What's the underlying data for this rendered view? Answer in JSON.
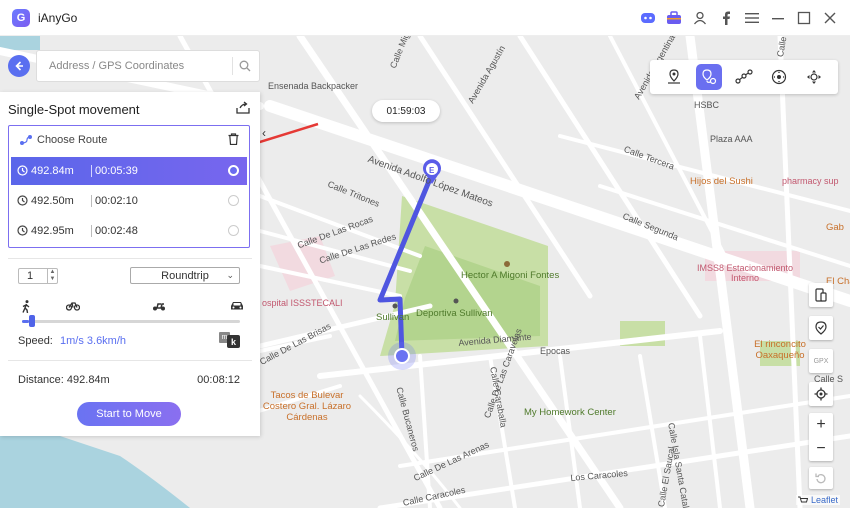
{
  "app": {
    "name": "iAnyGo",
    "logo_letter": "G"
  },
  "titlebar_icons": [
    "discord-icon",
    "toolbox-icon",
    "user-icon",
    "facebook-icon",
    "menu-icon",
    "minimize-icon",
    "maximize-icon",
    "close-icon"
  ],
  "search": {
    "placeholder": "Address / GPS Coordinates"
  },
  "panel": {
    "title": "Single-Spot movement",
    "choose_route_label": "Choose Route",
    "routes": [
      {
        "distance": "492.84m",
        "time": "00:05:39",
        "selected": true
      },
      {
        "distance": "492.50m",
        "time": "00:02:10",
        "selected": false
      },
      {
        "distance": "492.95m",
        "time": "00:02:48",
        "selected": false
      }
    ],
    "repeat_count": "1",
    "trip_mode": "Roundtrip",
    "speed_label": "Speed:",
    "speed_value": "1m/s  3.6km/h",
    "speed_fraction": 0.03,
    "speed_modes": [
      "walk-icon",
      "bike-icon",
      "scooter-icon",
      "car-icon"
    ],
    "distance_label": "Distance: 492.84m",
    "total_time": "00:08:12",
    "start_button": "Start to Move",
    "mk_m": "m",
    "mk_k": "k"
  },
  "timer": "01:59:03",
  "mode_bar": [
    "teleport-icon",
    "single-spot-icon",
    "multi-spot-icon",
    "joystick-icon",
    "jump-teleport-icon"
  ],
  "right_tools": {
    "gpx_label": "GPX"
  },
  "zoom": {
    "in": "+",
    "out": "−"
  },
  "attribution": "Leaflet",
  "map_labels": [
    "Ensenada Backpacker",
    "Calle Miguel Hidalgo",
    "Avenida Agustín",
    "Avenida Argentina",
    "Calle Castillo",
    "HSBC",
    "Plaza AAA",
    "Calle Tercera",
    "Hijos del Sushi",
    "pharmacy sup",
    "Calle Segunda",
    "Avenida Adolfo López Mateos",
    "Calle Tritones",
    "Calle De Las Rocas",
    "Calle De Las Redes",
    "Hector A Migoni Fontes",
    "IMSS8 Estacionamiento Interno",
    "Gab",
    "El Charro",
    "ospital ISSSTECALI",
    "Sullivan",
    "Deportiva Sullivan",
    "Calle De Las Brisas",
    "Avenida Diamante",
    "Epocas",
    "El rinconcito Oaxaqueño",
    "Calle S",
    "Tacos de Bulevar Costero Gral. Lázaro Cárdenas",
    "Calle Bucaneros",
    "Calle De Las Caravelas",
    "Calle Caraballa",
    "My Homework Center",
    "Calle Isla Santa Catalina",
    "Calle El Saucal",
    "Calle De Las Arenas",
    "Calle Caracoles",
    "Los Caracoles",
    "E"
  ]
}
